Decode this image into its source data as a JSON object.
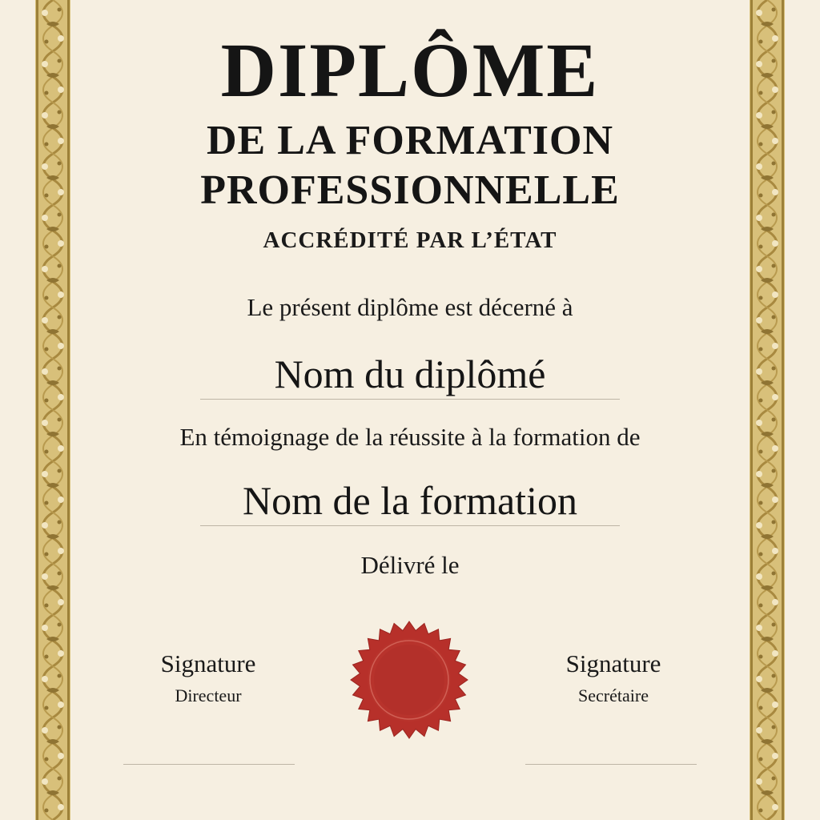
{
  "title": {
    "main": "DIPLÔME",
    "line1": "DE LA FORMATION",
    "line2": "PROFESSIONNELLE",
    "accreditation": "ACCRÉDITÉ PAR L’ÉTAT"
  },
  "body": {
    "awarded_to": "Le présent diplôme est décerné à",
    "graduate_name": "Nom du diplômé",
    "witness": "En témoignage de la réussite à la formation de",
    "course_name": "Nom de la formation",
    "issued_on": "Délivré le"
  },
  "signatures": [
    {
      "label": "Signature",
      "role": "Directeur"
    },
    {
      "label": "Signature",
      "role": "Secrétaire"
    }
  ],
  "colors": {
    "paper": "#f6efe1",
    "border_gold": "#c9ad5e",
    "seal_red": "#b7302a"
  },
  "icons": {
    "seal": "red-wax-seal-icon",
    "border": "ornamental-gold-border"
  }
}
